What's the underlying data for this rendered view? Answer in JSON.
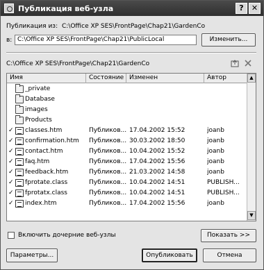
{
  "window": {
    "title": "Публикация веб-узла",
    "help_label": "?",
    "close_label": "✕"
  },
  "source": {
    "label": "Публикация из:",
    "value": "C:\\Office XP SES\\FrontPage\\Chap21\\GardenCo"
  },
  "dest": {
    "label": "в:",
    "value": "C:\\Office XP SES\\FrontPage\\Chap21\\PublicLocal",
    "change_button": "Изменить..."
  },
  "path_line": "C:\\Office XP SES\\FrontPage\\Chap21\\GardenCo",
  "columns": [
    "Имя",
    "Состояние",
    "Изменен",
    "Автор"
  ],
  "files": [
    {
      "checked": false,
      "type": "folder",
      "name": "_private",
      "status": "",
      "modified": "",
      "author": ""
    },
    {
      "checked": false,
      "type": "folder",
      "name": "Database",
      "status": "",
      "modified": "",
      "author": ""
    },
    {
      "checked": false,
      "type": "folder",
      "name": "images",
      "status": "",
      "modified": "",
      "author": ""
    },
    {
      "checked": false,
      "type": "folder",
      "name": "Products",
      "status": "",
      "modified": "",
      "author": ""
    },
    {
      "checked": true,
      "type": "file",
      "name": "classes.htm",
      "status": "Публиков...",
      "modified": "17.04.2002 15:52",
      "author": "joanb"
    },
    {
      "checked": true,
      "type": "file",
      "name": "confirmation.htm",
      "status": "Публиков...",
      "modified": "30.03.2002 18:50",
      "author": "joanb"
    },
    {
      "checked": true,
      "type": "file",
      "name": "contact.htm",
      "status": "Публиков...",
      "modified": "10.04.2002 15:52",
      "author": "joanb"
    },
    {
      "checked": true,
      "type": "file",
      "name": "faq.htm",
      "status": "Публиков...",
      "modified": "17.04.2002 15:56",
      "author": "joanb"
    },
    {
      "checked": true,
      "type": "file",
      "name": "feedback.htm",
      "status": "Публиков...",
      "modified": "21.03.2002 14:58",
      "author": "joanb"
    },
    {
      "checked": true,
      "type": "file",
      "name": "fprotate.class",
      "status": "Публиков...",
      "modified": "10.04.2002 14:51",
      "author": "PUBLISH..."
    },
    {
      "checked": true,
      "type": "file",
      "name": "fprotatx.class",
      "status": "Публиков...",
      "modified": "10.04.2002 14:51",
      "author": "PUBLISH..."
    },
    {
      "checked": true,
      "type": "file",
      "name": "index.htm",
      "status": "Публиков...",
      "modified": "17.04.2002 15:56",
      "author": "joanb"
    }
  ],
  "include_subwebs": {
    "label": "Включить дочерние веб-узлы",
    "checked": false
  },
  "buttons": {
    "show": "Показать >>",
    "options": "Параметры...",
    "publish": "Опубликовать",
    "cancel": "Отмена"
  }
}
